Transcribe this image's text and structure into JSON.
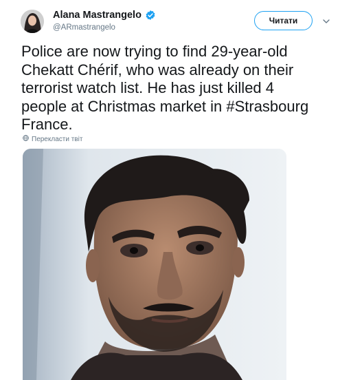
{
  "author": {
    "name": "Alana Mastrangelo",
    "handle": "@ARmastrangelo",
    "verified": true
  },
  "follow_button": {
    "label": "Читати"
  },
  "tweet": {
    "text": "Police are now trying to find 29-year-old\nChekatt Chérif, who was already on their\nterrorist watch list. He has just killed 4\npeople at Christmas market in #Strasbourg\nFrance.",
    "translate_label": "Перекласти твіт"
  },
  "icons": {
    "verified": "verified-badge-icon",
    "menu": "chevron-down-icon",
    "translate": "globe-icon"
  },
  "colors": {
    "accent": "#1da1f2",
    "text": "#14171a",
    "secondary": "#657786"
  }
}
